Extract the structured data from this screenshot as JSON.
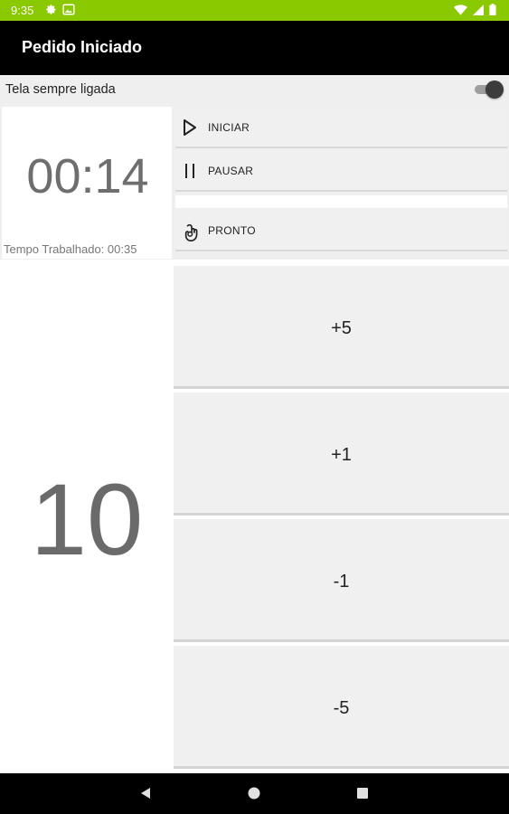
{
  "status_bar": {
    "time": "9:35",
    "icons_left": [
      "settings-icon",
      "image-notification-icon"
    ],
    "icons_right": [
      "wifi-icon",
      "signal-icon",
      "battery-icon"
    ],
    "color": "#8ac800"
  },
  "app_bar": {
    "title": "Pedido Iniciado"
  },
  "keep_screen_on": {
    "label": "Tela sempre ligada",
    "enabled": true
  },
  "timer": {
    "value": "00:14",
    "worked_time_label": "Tempo Trabalhado: 00:35"
  },
  "actions": {
    "start": {
      "label": "INICIAR",
      "icon": "play-icon"
    },
    "pause": {
      "label": "PAUSAR",
      "icon": "pause-icon"
    },
    "ready": {
      "label": "PRONTO",
      "icon": "ok-hand-icon"
    }
  },
  "counter": {
    "value": "10",
    "steps": {
      "plus5": "+5",
      "plus1": "+1",
      "minus1": "-1",
      "minus5": "-5"
    }
  },
  "nav_bar": {
    "buttons": [
      "back-icon",
      "home-icon",
      "recents-icon"
    ]
  }
}
